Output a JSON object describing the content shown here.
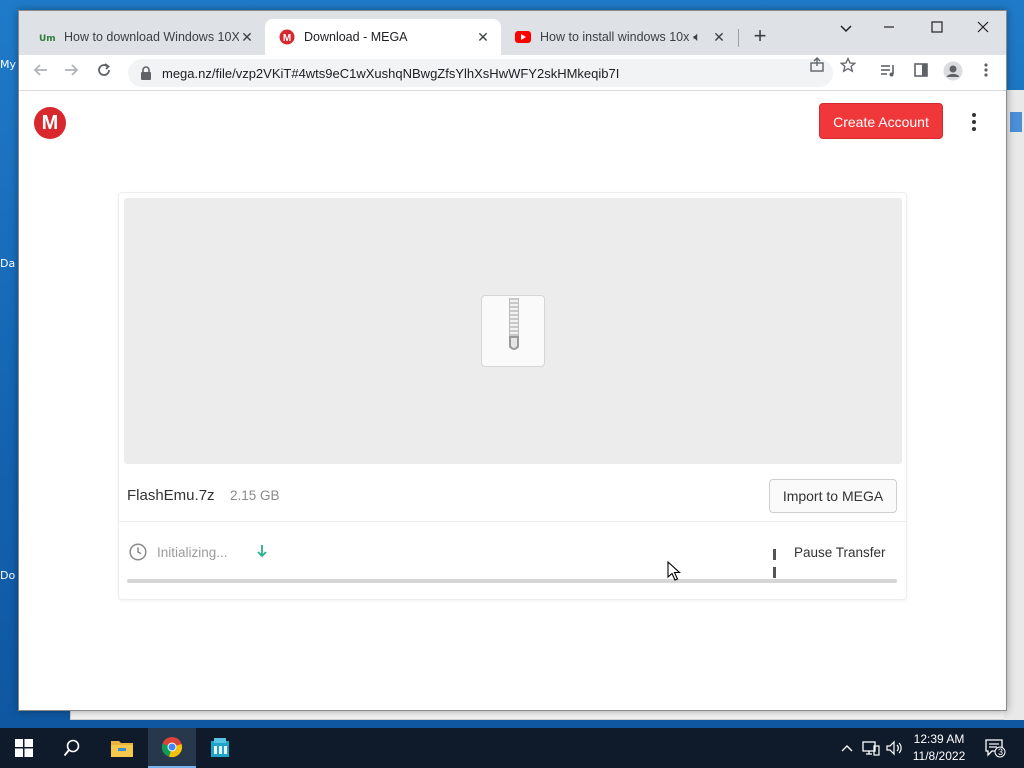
{
  "desktop": {
    "fragments": [
      "My",
      "Da",
      "Do"
    ]
  },
  "browser": {
    "tabs": [
      {
        "title": "How to download Windows 10X",
        "favicon": "umix-icon",
        "active": false
      },
      {
        "title": "Download - MEGA",
        "favicon": "mega-icon",
        "active": true
      },
      {
        "title": "How to install windows 10x",
        "favicon": "youtube-icon",
        "active": false,
        "audio": true
      }
    ],
    "address": "mega.nz/file/vzp2VKiT#4wts9eC1wXushqNBwgZfsYlhXsHwWFY2skHMkeqib7I"
  },
  "mega": {
    "logo_letter": "M",
    "create_account_label": "Create Account",
    "file_name": "FlashEmu.7z",
    "file_size": "2.15 GB",
    "import_label": "Import to MEGA",
    "status_text": "Initializing...",
    "pause_label": "Pause Transfer",
    "progress_fraction": 0.0
  },
  "taskbar": {
    "time": "12:39 AM",
    "date": "11/8/2022",
    "notification_count": "3"
  },
  "colors": {
    "mega_red": "#d9272e",
    "create_button": "#f0373a",
    "download_green": "#23b08b",
    "taskbar": "#0f1a2a"
  }
}
